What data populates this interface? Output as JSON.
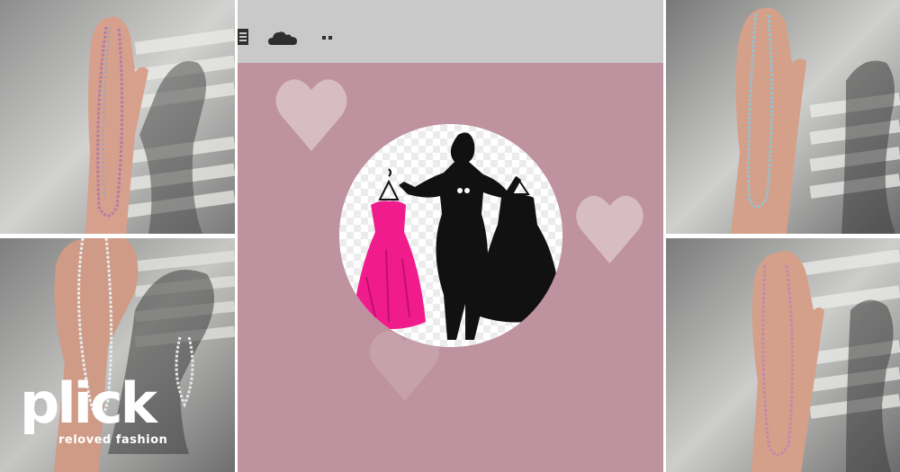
{
  "brand": {
    "logo_text": "plick",
    "tagline": "reloved fashion"
  },
  "photos": [
    {
      "subject": "hand-holding-pink-blue-bead-necklace"
    },
    {
      "subject": "hand-holding-white-bead-necklace"
    },
    {
      "subject": "hand-holding-light-blue-bead-necklace"
    },
    {
      "subject": "hand-holding-pink-bead-necklace"
    }
  ],
  "center_panel": {
    "background_color": "#be929e",
    "topbar_color": "#c9c9c9",
    "icons": [
      "list-icon",
      "cloud-icon",
      "more-icon"
    ],
    "profile_image": "woman-silhouette-with-dresses",
    "accent_colors": {
      "pink_dress": "#f01c8c",
      "silhouette": "#111111",
      "heart": "#dcc3c9"
    }
  }
}
